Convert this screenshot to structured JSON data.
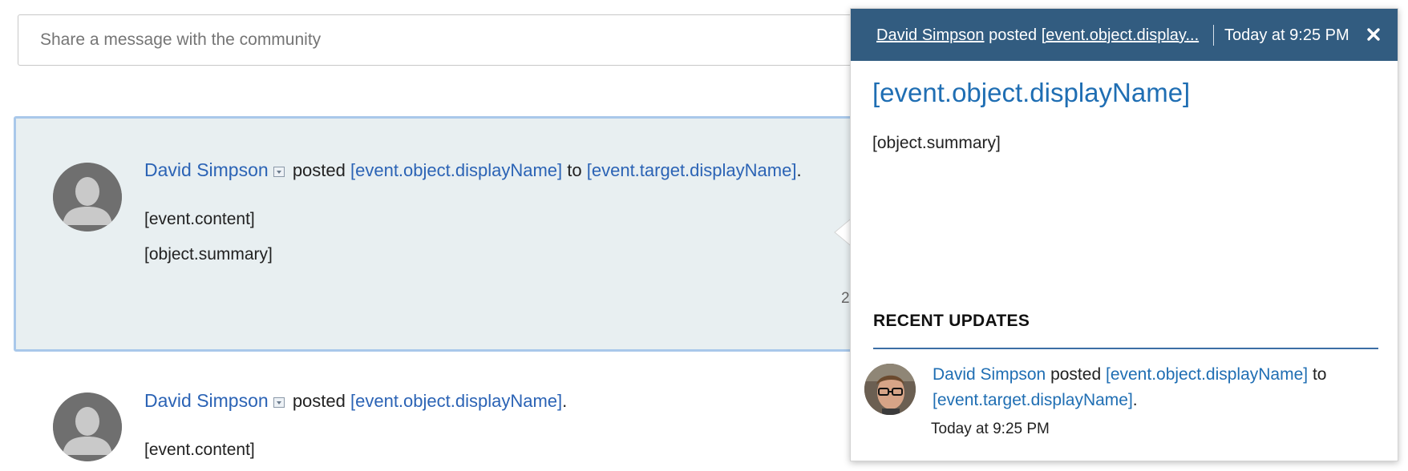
{
  "share": {
    "placeholder": "Share a message with the community"
  },
  "feed": {
    "items": [
      {
        "author": "David Simpson",
        "verb": "posted",
        "object": "[event.object.displayName]",
        "to": "to",
        "target": "[event.target.displayName]",
        "end": ".",
        "content": "[event.content]",
        "summary": "[object.summary]",
        "time_peek": "2"
      },
      {
        "author": "David Simpson",
        "verb": "posted",
        "object": "[event.object.displayName]",
        "end": ".",
        "content": "[event.content]"
      }
    ]
  },
  "popup": {
    "header": {
      "author": "David Simpson",
      "verb": "posted",
      "object_truncated": "[event.object.display",
      "ellipsis": "...",
      "time": "Today at 9:25 PM",
      "close_icon": "close-icon"
    },
    "title": "[event.object.displayName]",
    "summary": "[object.summary]",
    "recent": {
      "heading": "RECENT UPDATES",
      "author": "David Simpson",
      "verb": "posted",
      "object": "[event.object.displayName]",
      "to": "to",
      "target": "[event.target.displayName]",
      "end": ".",
      "time": "Today at 9:25 PM"
    }
  },
  "colors": {
    "link": "#2b63b5",
    "header_bg": "#325c80",
    "selected_bg": "#e8eff1",
    "selected_border": "#a9c8ea",
    "rule": "#3b6ea5"
  }
}
